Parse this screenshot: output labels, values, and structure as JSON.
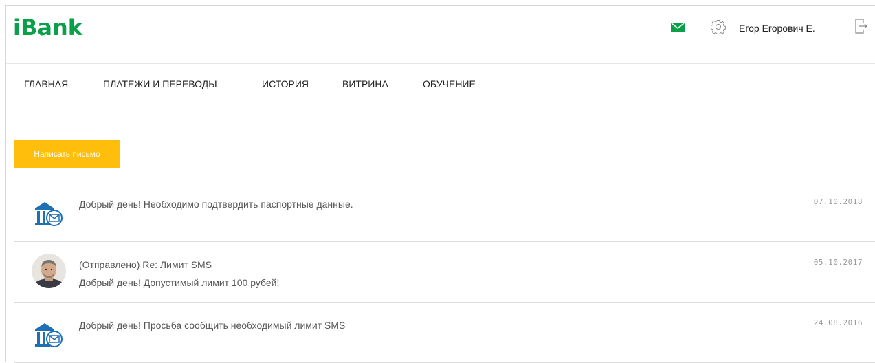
{
  "app": {
    "logo": "iBank",
    "accent_color": "#0aa04a",
    "button_color": "#ffbe0b"
  },
  "header": {
    "mail_icon": "mail-icon",
    "settings_icon": "gear-icon",
    "user_name": "Егор Егорович Е.",
    "logout_icon": "logout-icon"
  },
  "nav": {
    "items": [
      {
        "label": "ГЛАВНАЯ"
      },
      {
        "label": "ПЛАТЕЖИ И ПЕРЕВОДЫ"
      },
      {
        "label": "ИСТОРИЯ"
      },
      {
        "label": "ВИТРИНА"
      },
      {
        "label": "ОБУЧЕНИЕ"
      }
    ]
  },
  "actions": {
    "write_letter": "Написать письмо"
  },
  "messages": [
    {
      "sender": "bank",
      "icon": "bank-mail-icon",
      "subject": "Добрый день! Необходимо подтвердить паспортные данные.",
      "body": "",
      "date": "07.10.2018"
    },
    {
      "sender": "user",
      "icon": "avatar",
      "subject": "(Отправлено) Re: Лимит SMS",
      "body": "Добрый день! Допустимый лимит 100 рубей!",
      "date": "05.10.2017"
    },
    {
      "sender": "bank",
      "icon": "bank-mail-icon",
      "subject": "Добрый день! Просьба сообщить необходимый лимит SMS",
      "body": "",
      "date": "24.08.2016"
    }
  ]
}
